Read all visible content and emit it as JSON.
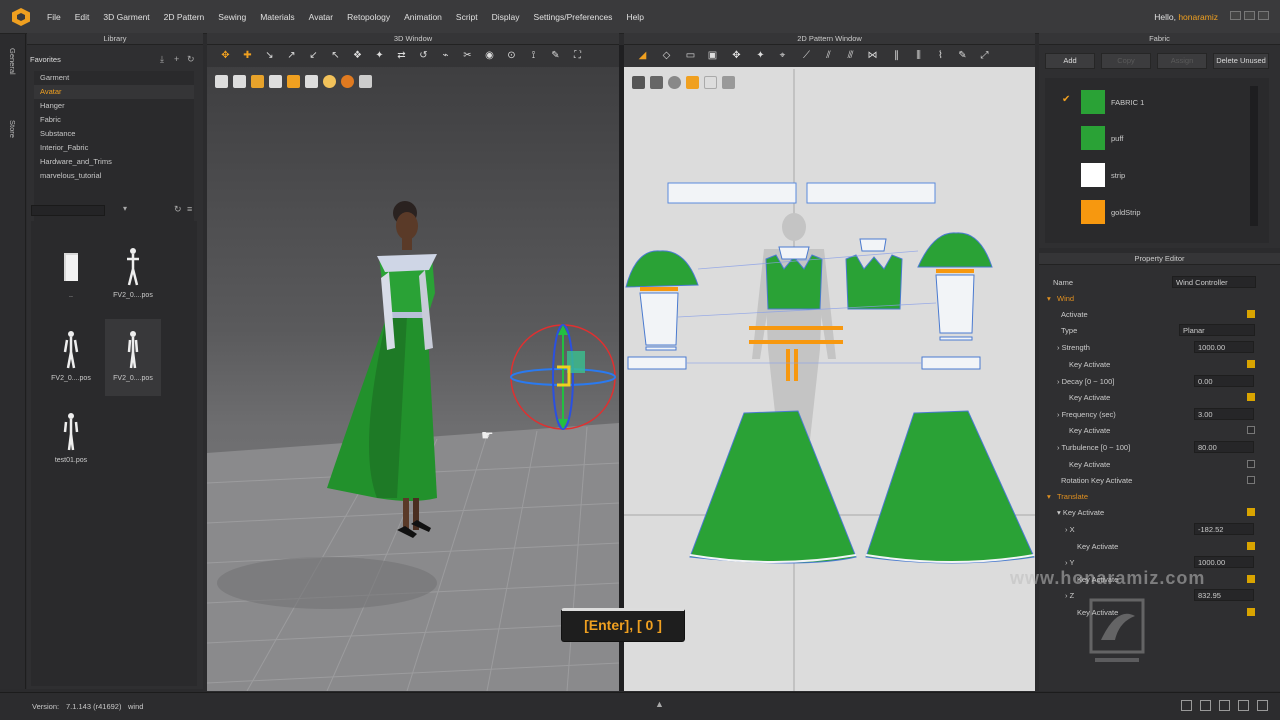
{
  "app": {
    "menu": [
      "File",
      "Edit",
      "3D Garment",
      "2D Pattern",
      "Sewing",
      "Materials",
      "Avatar",
      "Retopology",
      "Animation",
      "Script",
      "Display",
      "Settings/Preferences",
      "Help"
    ],
    "greeting": "Hello,",
    "user": "honaramiz"
  },
  "sidetabs": [
    "General",
    "Store"
  ],
  "library": {
    "title": "Library",
    "favorites_label": "Favorites",
    "items": [
      "Garment",
      "Avatar",
      "Hanger",
      "Fabric",
      "Substance",
      "Interior_Fabric",
      "Hardware_and_Trims",
      "marvelous_tutorial"
    ],
    "selected_index": 1,
    "thumbs": [
      "..",
      "FV2_0....pos",
      "FV2_0....pos",
      "FV2_0....pos",
      "test01.pos"
    ]
  },
  "window3d": {
    "title": "3D Window"
  },
  "window2d": {
    "title": "2D Pattern Window"
  },
  "fabric": {
    "title": "Fabric",
    "buttons": {
      "add": "Add",
      "copy": "Copy",
      "assign": "Assign",
      "delete_unused": "Delete Unused"
    },
    "items": [
      {
        "name": "FABRIC 1",
        "color": "#2aa236",
        "checked": true
      },
      {
        "name": "puff",
        "color": "#2aa236",
        "checked": false
      },
      {
        "name": "strip",
        "color": "#ffffff",
        "checked": false
      },
      {
        "name": "goldStrip",
        "color": "#f7980f",
        "checked": false
      }
    ]
  },
  "property_editor": {
    "title": "Property Editor",
    "name_label": "Name",
    "name_value": "Wind Controller",
    "wind_section": "Wind",
    "activate": "Activate",
    "type_label": "Type",
    "type_value": "Planar",
    "strength_label": "Strength",
    "strength_value": "1000.00",
    "key_activate": "Key Activate",
    "decay_label": "Decay [0 ~ 100]",
    "decay_value": "0.00",
    "frequency_label": "Frequency (sec)",
    "frequency_value": "3.00",
    "turbulence_label": "Turbulence [0 ~ 100]",
    "turbulence_value": "80.00",
    "rotation_key": "Rotation Key Activate",
    "translate_section": "Translate",
    "x_label": "X",
    "x_value": "-182.52",
    "y_label": "Y",
    "y_value": "1000.00",
    "z_label": "Z",
    "z_value": "832.95"
  },
  "status": {
    "version_label": "Version:",
    "version_value": "7.1.143 (r41692)",
    "mode": "wind"
  },
  "overlay": {
    "shortcut": "[Enter], [ 0 ]",
    "watermark": "www.honaramiz.com"
  },
  "colors": {
    "accent": "#f0a020",
    "garment_green": "#2aa236",
    "gold": "#f7980f"
  }
}
